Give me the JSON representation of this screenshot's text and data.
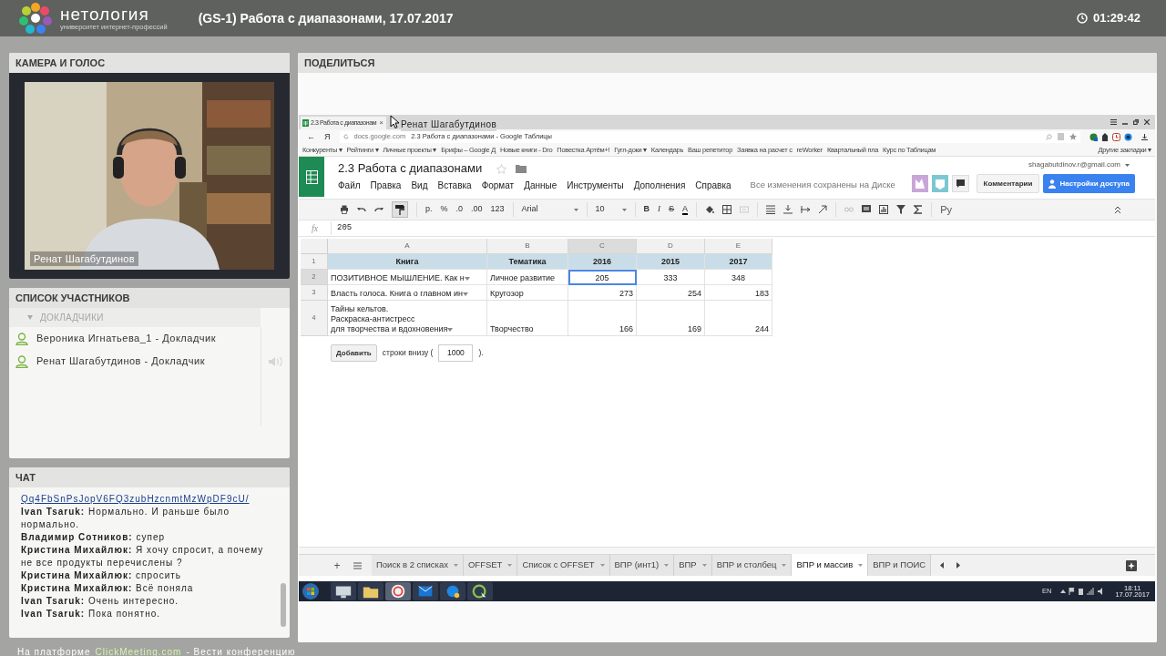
{
  "header": {
    "logo_name": "нетология",
    "logo_tagline": "университет интернет-профессий",
    "title": "(GS-1) Работа с диапазонами, 17.07.2017",
    "timer": "01:29:42"
  },
  "camera_panel": {
    "title": "КАМЕРА И ГОЛОС",
    "video_caption": "Ренат Шагабутдинов"
  },
  "participants": {
    "title": "СПИСОК УЧАСТНИКОВ",
    "group": {
      "label": "ДОКЛАДЧИКИ",
      "expanded": true
    },
    "people": [
      {
        "name": "Вероника Игнатьева_1 - Докладчик",
        "speaking": false
      },
      {
        "name": "Ренат Шагабутдинов - Докладчик",
        "speaking": true
      }
    ]
  },
  "chat": {
    "title": "ЧАТ",
    "messages": [
      {
        "kind": "link",
        "text": "Qq4FbSnPsJopV6FQ3zubHzcnmtMzWpDF9cU/"
      },
      {
        "kind": "message",
        "author": "Ivan Tsaruk:",
        "text": "Нормально. И раньше было нормально."
      },
      {
        "kind": "message",
        "author": "Владимир Сотников:",
        "text": "супер"
      },
      {
        "kind": "message",
        "author": "Кристина Михайлюк:",
        "text": "Я хочу спросит, а почему не все продукты перечислены ?"
      },
      {
        "kind": "message",
        "author": "Кристина Михайлюк:",
        "text": "спросить"
      },
      {
        "kind": "message",
        "author": "Кристина Михайлюк:",
        "text": "Всё поняла"
      },
      {
        "kind": "message",
        "author": "Ivan Tsaruk:",
        "text": "Очень интересно."
      },
      {
        "kind": "message",
        "author": "Ivan Tsaruk:",
        "text": "Пока понятно."
      }
    ]
  },
  "footer": {
    "prefix": "На платформе",
    "brand": "ClickMeeting.com",
    "suffix": "- Вести конференцию"
  },
  "share": {
    "title": "ПОДЕЛИТЬСЯ",
    "presenter_label": "Ренат Шагабутдинов",
    "browser": {
      "tab_title": "2.3 Работа с диапазонам",
      "tab_close": "×",
      "back": "←",
      "yandex": "Я",
      "domain": "docs.google.com",
      "page_title": "2.3 Работа с диапазонами - Google Таблицы",
      "bookmarks": [
        "Конкуренты ▾",
        "Рейтинги ▾",
        "Личные проекты ▾",
        "Брифы – Google Д",
        "Новые книги - Dro",
        "Повестка Артём+!",
        "Гугл-доки ▾",
        "Календарь",
        "Ваш репетитор",
        "Заявка на расчет с",
        "reWorker",
        "Квартальный пла",
        "Курс по Таблицам"
      ],
      "other_bookmarks": "Другие закладки ▾"
    },
    "sheet": {
      "title": "2.3 Работа с диапазонами",
      "menu": [
        "Файл",
        "Правка",
        "Вид",
        "Вставка",
        "Формат",
        "Данные",
        "Инструменты",
        "Дополнения",
        "Справка"
      ],
      "save_status": "Все изменения сохранены на Диске",
      "account": "shagabutdinov.r@gmail.com",
      "comments_button": "Комментарии",
      "share_button": "Настройки доступа",
      "toolbar": {
        "currency": "р.",
        "percent": "%",
        "decimal_less": ".0",
        "decimal_more": ".00",
        "number_format": "123",
        "font": "Arial",
        "font_size": "10",
        "bold": "B",
        "italic": "I",
        "strikethrough": "S",
        "text_color": "A",
        "input_tools": "Ру"
      },
      "formula_label": "fx",
      "formula": "205",
      "columns": [
        {
          "label": "A",
          "selected": false
        },
        {
          "label": "B",
          "selected": false
        },
        {
          "label": "C",
          "selected": true
        },
        {
          "label": "D",
          "selected": false
        },
        {
          "label": "E",
          "selected": false
        }
      ],
      "rows": [
        {
          "number": "1",
          "kind": "header",
          "selected": false,
          "cells": [
            {
              "text": "Книга"
            },
            {
              "text": "Тематика"
            },
            {
              "text": "2016"
            },
            {
              "text": "2015"
            },
            {
              "text": "2017"
            }
          ]
        },
        {
          "number": "2",
          "kind": "centered",
          "selected": true,
          "cells": [
            {
              "text": "ПОЗИТИВНОЕ МЫШЛЕНИЕ. Как н",
              "dropdown": true,
              "selected": false
            },
            {
              "text": "Личное развитие",
              "dropdown": false,
              "selected": false
            },
            {
              "text": "205",
              "dropdown": false,
              "selected": true
            },
            {
              "text": "333",
              "dropdown": false,
              "selected": false
            },
            {
              "text": "348",
              "dropdown": false,
              "selected": false
            }
          ]
        },
        {
          "number": "3",
          "kind": "plain",
          "selected": false,
          "cells": [
            {
              "text": "Власть голоса. Книга о главном ин",
              "dropdown": true,
              "selected": false
            },
            {
              "text": "Кругозор",
              "dropdown": false,
              "selected": false
            },
            {
              "text": "273",
              "dropdown": false,
              "selected": false
            },
            {
              "text": "254",
              "dropdown": false,
              "selected": false
            },
            {
              "text": "183",
              "dropdown": false,
              "selected": false
            }
          ]
        },
        {
          "number": "4",
          "kind": "plain",
          "selected": false,
          "cells": [
            {
              "text": "Тайны кельтов.\nРаскраска-антистресс\nдля творчества и вдохновения",
              "dropdown": true,
              "selected": false
            },
            {
              "text": "Творчество",
              "dropdown": false,
              "selected": false
            },
            {
              "text": "166",
              "dropdown": false,
              "selected": false
            },
            {
              "text": "169",
              "dropdown": false,
              "selected": false
            },
            {
              "text": "244",
              "dropdown": false,
              "selected": false
            }
          ]
        }
      ],
      "add_button": "Добавить",
      "add_text": "строки внизу (",
      "add_count": "1000",
      "add_end": ").",
      "sheet_tabs": [
        {
          "label": "Поиск в 2 списках",
          "selected": false
        },
        {
          "label": "OFFSET",
          "selected": false
        },
        {
          "label": "Список с OFFSET",
          "selected": false
        },
        {
          "label": "ВПР (инт1)",
          "selected": false
        },
        {
          "label": "ВПР",
          "selected": false
        },
        {
          "label": "ВПР и столбец",
          "selected": false
        },
        {
          "label": "ВПР и массив",
          "selected": true
        },
        {
          "label": "ВПР и ПОИС",
          "selected": false
        }
      ],
      "add_sheet": "+"
    },
    "taskbar": {
      "language": "EN",
      "time": "18:11",
      "date": "17.07.2017"
    }
  }
}
